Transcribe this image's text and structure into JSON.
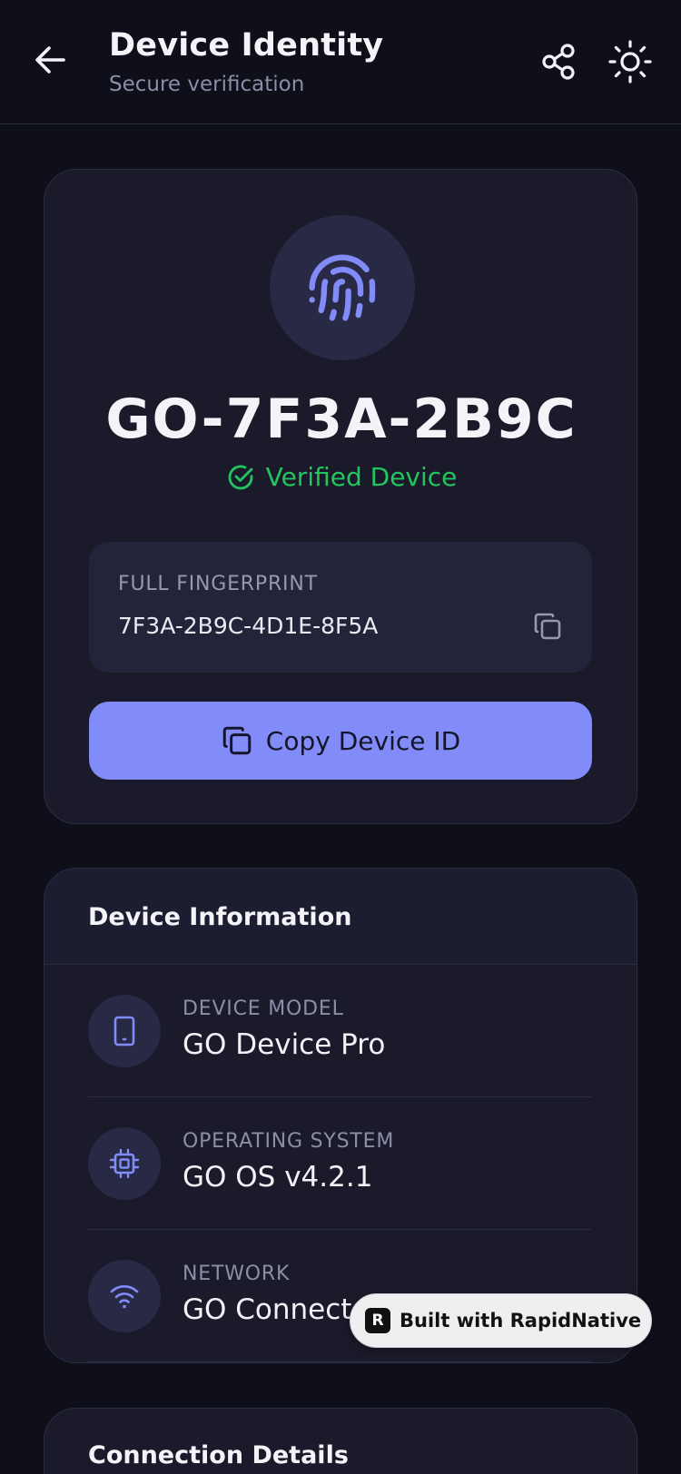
{
  "header": {
    "title": "Device Identity",
    "subtitle": "Secure verification"
  },
  "identity": {
    "device_id": "GO-7F3A-2B9C",
    "status": "Verified Device",
    "fingerprint_label": "FULL FINGERPRINT",
    "fingerprint_value": "7F3A-2B9C-4D1E-8F5A",
    "copy_button_label": "Copy Device ID"
  },
  "device_info": {
    "title": "Device Information",
    "rows": [
      {
        "label": "DEVICE MODEL",
        "value": "GO Device Pro",
        "icon": "phone-icon"
      },
      {
        "label": "OPERATING SYSTEM",
        "value": "GO OS v4.2.1",
        "icon": "chip-icon"
      },
      {
        "label": "NETWORK",
        "value": "GO Connect",
        "icon": "wifi-icon"
      }
    ]
  },
  "connection": {
    "title": "Connection Details"
  },
  "badge": {
    "logo": "R",
    "label": "Built with RapidNative"
  },
  "colors": {
    "background": "#0f0f1a",
    "card": "#1a1a2b",
    "accent": "#818cf8",
    "success": "#22c55e"
  }
}
